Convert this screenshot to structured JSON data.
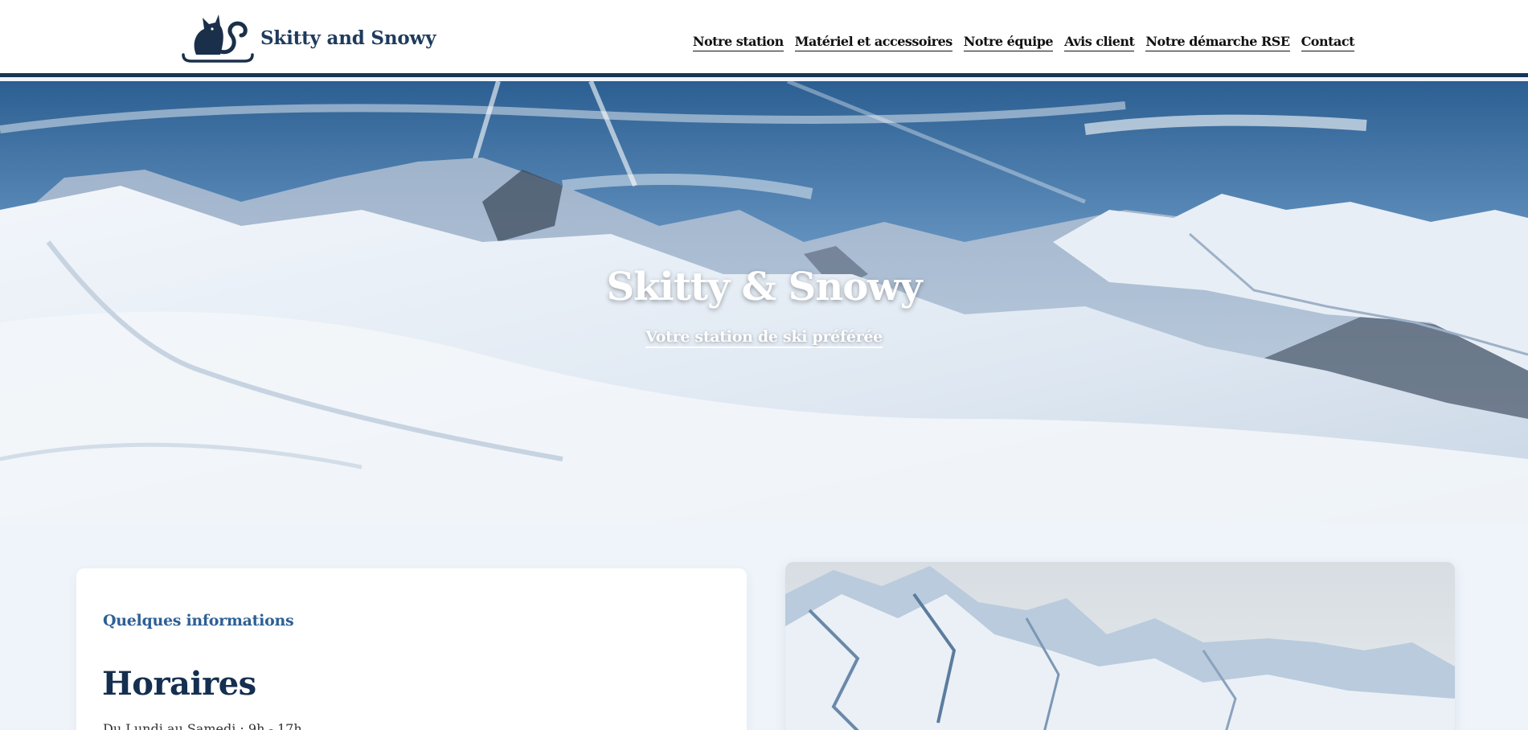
{
  "site": {
    "brand": "Skitty and Snowy",
    "logo_icon": "cat-sled-logo"
  },
  "nav": {
    "items": [
      {
        "label": "Notre station"
      },
      {
        "label": "Matériel et accessoires"
      },
      {
        "label": "Notre équipe"
      },
      {
        "label": "Avis client"
      },
      {
        "label": "Notre démarche RSE"
      },
      {
        "label": "Contact"
      }
    ]
  },
  "hero": {
    "title": "Skitty & Snowy",
    "subtitle": "Votre station de ski préférée",
    "image": "snowy-mountain-panorama"
  },
  "info": {
    "eyebrow": "Quelques informations",
    "title": "Horaires",
    "text": "Du Lundi au Samedi : 9h - 17h"
  },
  "photo": {
    "image": "mountain-peaks-photo"
  },
  "colors": {
    "navy": "#163453",
    "accent": "#2d6095",
    "background": "#eff4fa"
  }
}
